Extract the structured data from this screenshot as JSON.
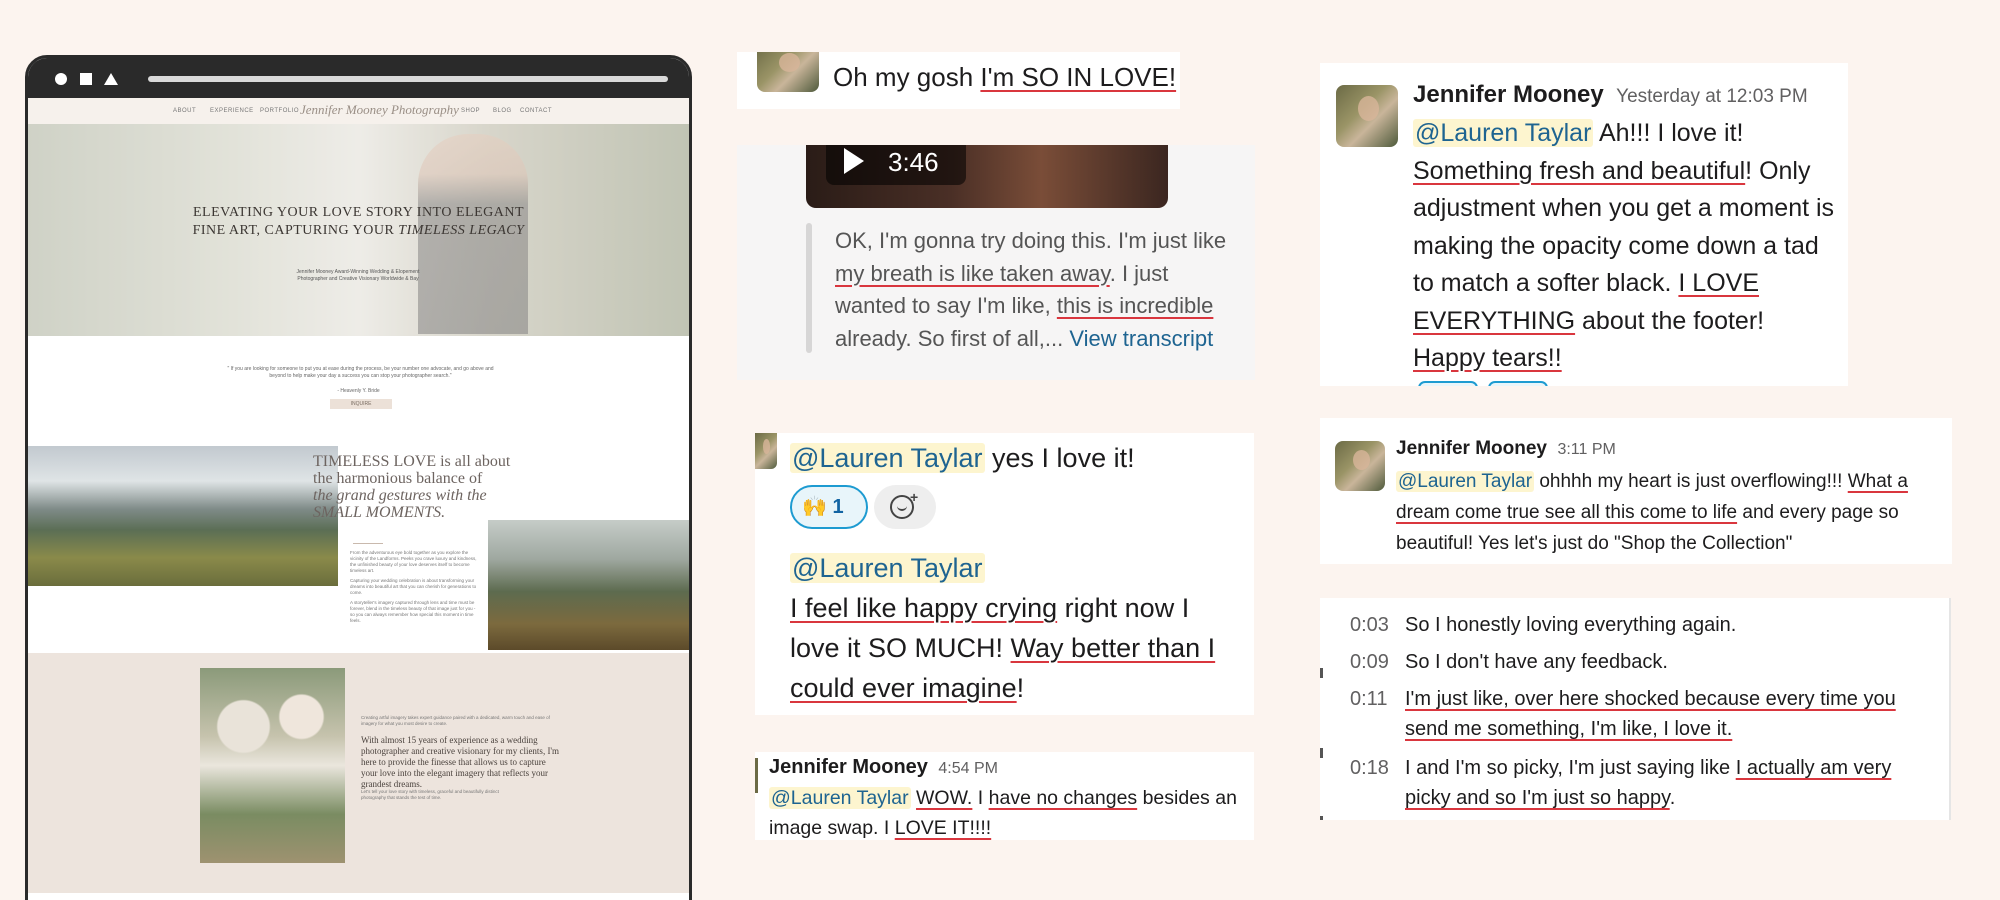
{
  "laptop": {
    "nav_left": [
      "ABOUT",
      "EXPERIENCE",
      "PORTFOLIO"
    ],
    "logo": "Jennifer Mooney Photography",
    "nav_right": [
      "SHOP",
      "BLOG",
      "CONTACT"
    ],
    "hero_line1": "ELEVATING YOUR LOVE STORY INTO ELEGANT",
    "hero_line2": "FINE ART, CAPTURING YOUR",
    "hero_line2_em": "TIMELESS LEGACY",
    "hero_sub": "Jennifer Mooney Award-Winning Wedding & Elopement Photographer and Creative Visionary Worldwide & Bay",
    "quote": "\" If you are looking for someone to put you at ease during the process, be your number one advocate, and go above and beyond to help make your day a success you can stop your photographer search.\"",
    "quote_by": "- Heavenly Y. Bride",
    "inquire": "INQUIRE",
    "timeless1": "TIMELESS LOVE is all about",
    "timeless2": "the harmonious balance of",
    "timeless3": "the grand gestures with the",
    "timeless4": "SMALL MOMENTS.",
    "body1": "From the adventurous eye bold together as you explore the vicinity of the Landforms. Peeks you crave luxury and kindness, the unfinished beauty of your love deserves itself to become timeless art.",
    "body2": "Capturing your wedding celebration is about transforming your dreams into beautiful art that you can cherish for generations to come.",
    "body3": "A storyteller's imagery captured through lens and time must be forever, blend in the timeless beauty of that image just for you - so you can always remember how special this moment in time feels.",
    "exp_small": "Creating artful imagery takes expert guidance paired with a dedicated, warm touch and ease of imagery for what you most desire to create.",
    "exp_big": "With almost 15 years of experience as a wedding photographer and creative visionary for my clients, I'm here to provide the finesse that allows us to capture your love into the elegant imagery that reflects your grandest dreams.",
    "exp_small2": "Let's tell your love story with timeless, graceful and beautifully distinct photography that stands the test of time."
  },
  "c1": {
    "text_pre": "Oh my gosh ",
    "text_ul": "I'm SO IN LOVE!",
    "text_post": " \\"
  },
  "c2": {
    "duration": "3:46",
    "line1_a": "OK, I'm gonna try doing this. I'm just like",
    "line2_ul": "my breath is like taken away",
    "line2_b": ". I just",
    "line3_a": "wanted to say I'm like, ",
    "line3_ul": "this is incredible",
    "line4_a": "already. So first of all,... ",
    "link": "View transcript"
  },
  "c3": {
    "mention": "@Lauren Taylar",
    "text1": " yes I love it!",
    "reaction_emoji": "🙌",
    "reaction_count": "1",
    "mention2": "@Lauren Taylar",
    "ul1": "I feel like happy crying",
    "t1": " right now I love it SO MUCH!  ",
    "ul2": "Way better than I could ever imagine",
    "t2": "!"
  },
  "c4": {
    "name": "Jennifer Mooney",
    "time": "4:54 PM",
    "mention": "@Lauren Taylar",
    "ul1": "WOW.",
    "t1": "  I ",
    "ul2": "have no changes",
    "t2": " besides an image swap. I ",
    "ul3": "LOVE IT!!!!"
  },
  "c5": {
    "name": "Jennifer Mooney",
    "time": "Yesterday at 12:03 PM",
    "mention": "@Lauren Taylar",
    "t1": " Ah!!! I love it!",
    "ul1": "Something fresh and beautiful",
    "t2": "!  Only adjustment when you get a moment is making the opacity come down a tad to match a softer black.  ",
    "ul2": "I LOVE EVERYTHING",
    "t3": " about the footer!",
    "ul3": "Happy tears!!"
  },
  "c6": {
    "name": "Jennifer Mooney",
    "time": "3:11 PM",
    "mention": "@Lauren Taylar",
    "t1": " ohhhh my heart is just overflowing!!!",
    "ul1": "What a dream come true see all this come to life",
    "t2": " and every page so beautiful!  Yes let's just do \"Shop the Collection\""
  },
  "c7": {
    "rows": [
      {
        "ts": "0:03",
        "text": "So I honestly loving everything again.",
        "ul": ""
      },
      {
        "ts": "0:09",
        "text": "So I don't have any feedback.",
        "ul": ""
      },
      {
        "ts": "0:11",
        "text": "",
        "ul": "I'm just like, over here shocked because every time you send me something, I'm like, I love it."
      },
      {
        "ts": "0:18",
        "text": "I and I'm so picky, I'm just saying like ",
        "ul": "I actually am very picky and so I'm just so happy",
        "tail": "."
      }
    ]
  }
}
